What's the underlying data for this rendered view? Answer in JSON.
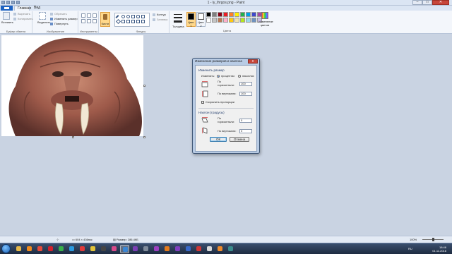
{
  "window": {
    "title": "1 - ly_lhrgos.png - Paint",
    "controls": [
      "–",
      "□",
      "✕"
    ]
  },
  "tabs": {
    "file": "",
    "home": "Главная",
    "view": "Вид"
  },
  "ribbon": {
    "clipboard": {
      "paste": "Вставить",
      "cut": "Вырезать",
      "copy": "Копировать",
      "label": "Буфер обмена"
    },
    "image": {
      "select": "Выделить",
      "crop": "Обрезать",
      "resize": "Изменить размер",
      "rotate": "Повернуть",
      "label": "Изображение"
    },
    "tools": {
      "label": "Инструменты"
    },
    "brushes": {
      "label": "Кисти"
    },
    "shapes": {
      "outline": "Контур",
      "fill": "Заливка",
      "label": "Фигуры"
    },
    "size": {
      "label": "Толщина"
    },
    "colors": {
      "color1": "Цвет 1",
      "color2": "Цвет 2",
      "edit": "Изменение цветов",
      "label": "Цвета",
      "color1_hex": "#000000",
      "color2_hex": "#ffffff"
    },
    "palette": [
      "#000000",
      "#7f7f7f",
      "#880015",
      "#ed1c24",
      "#ff7f27",
      "#fff200",
      "#22b14c",
      "#00a2e8",
      "#3f48cc",
      "#a349a4",
      "#ffffff",
      "#c3c3c3",
      "#b97a57",
      "#ffaec9",
      "#ffc90e",
      "#efe4b0",
      "#b5e61d",
      "#99d9ea",
      "#7092be",
      "#c8bfe7"
    ]
  },
  "dialog": {
    "title": "Изменение размеров и наклона",
    "close": "x",
    "resize_section": "Изменить размер",
    "by_label": "Изменить:",
    "percent_label": "процентах",
    "pixels_label": "пикселях",
    "horizontal_label": "По горизонтали:",
    "horizontal_value": "100",
    "vertical_label": "По вертикали:",
    "vertical_value": "100",
    "keep_ratio_label": "Сохранить пропорции",
    "keep_ratio_checked": true,
    "skew_section": "Наклон (градусы)",
    "skew_horizontal_label": "По горизонтали:",
    "skew_horizontal_value": "0",
    "skew_vertical_label": "По вертикали:",
    "skew_vertical_value": "0",
    "ok": "ОК",
    "cancel": "Отмена"
  },
  "status": {
    "dimensions": "604 × 436пкс",
    "size": "Размер: 286,4КБ",
    "zoom": "100%"
  },
  "taskbar": {
    "apps": [
      {
        "name": "explorer",
        "color": "#e5b84a"
      },
      {
        "name": "media-player",
        "color": "#f08a1c"
      },
      {
        "name": "chrome",
        "color": "#e64a3b"
      },
      {
        "name": "opera",
        "color": "#d3202c"
      },
      {
        "name": "app-green",
        "color": "#37b04a"
      },
      {
        "name": "app-skype",
        "color": "#2b9ae0"
      },
      {
        "name": "app-red",
        "color": "#e13a3a"
      },
      {
        "name": "app-yellow",
        "color": "#e2c33a"
      },
      {
        "name": "app-dark",
        "color": "#454545"
      },
      {
        "name": "app-pink",
        "color": "#d84a8a"
      },
      {
        "name": "paint",
        "color": "#3a86d4",
        "active": true
      },
      {
        "name": "app-purple",
        "color": "#7a3fb5"
      },
      {
        "name": "app-gray",
        "color": "#7e8a9a"
      },
      {
        "name": "app-violet",
        "color": "#9c40c0"
      },
      {
        "name": "app-orange",
        "color": "#e37a1d"
      },
      {
        "name": "app-purple2",
        "color": "#7f3fbf"
      },
      {
        "name": "app-blue",
        "color": "#3768c9"
      },
      {
        "name": "app-red2",
        "color": "#cd3636"
      },
      {
        "name": "app-white",
        "color": "#d9d9d9"
      },
      {
        "name": "app-orange2",
        "color": "#ee8a2a"
      },
      {
        "name": "app-teal",
        "color": "#3a8c8c"
      }
    ],
    "lang": "RU",
    "time": "18:46",
    "date": "01.11.2016"
  }
}
